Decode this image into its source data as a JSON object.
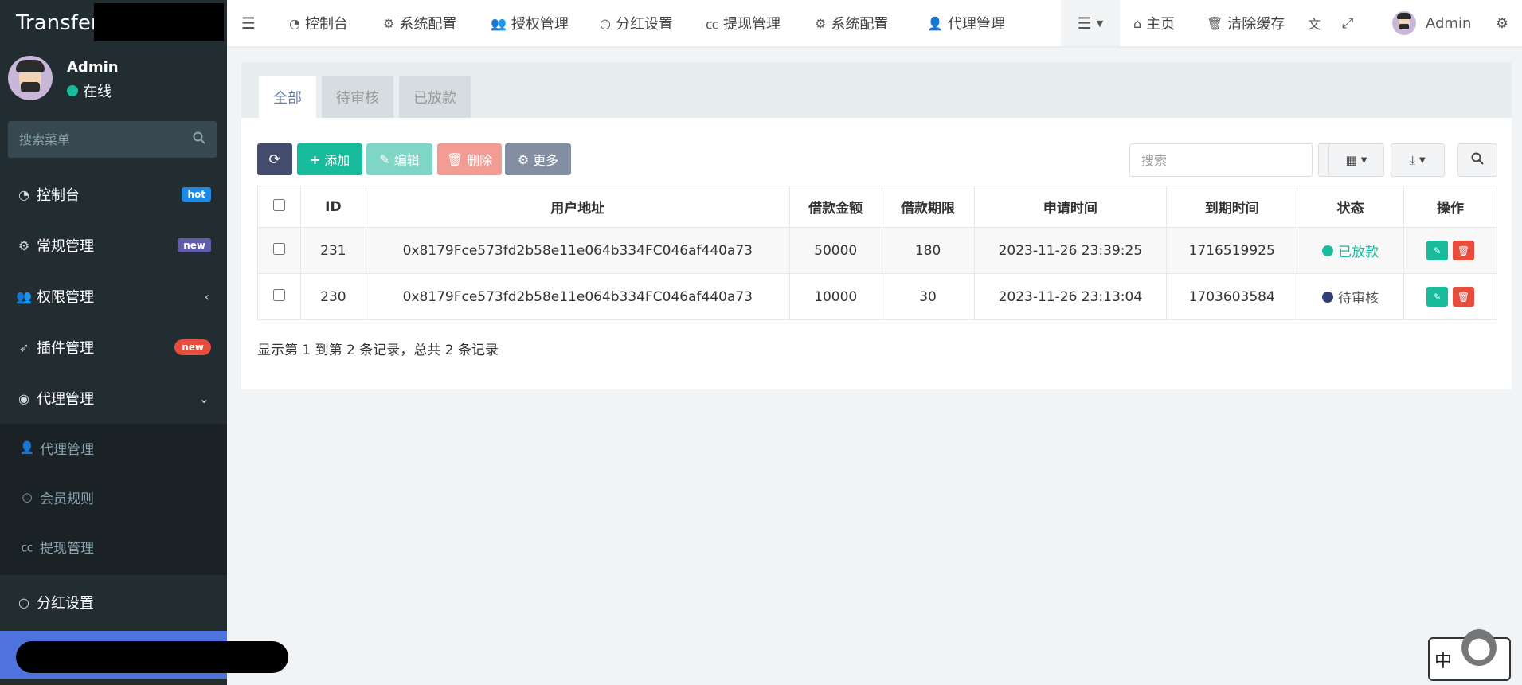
{
  "brand": {
    "title": "Transfer"
  },
  "user": {
    "name": "Admin",
    "status": "在线"
  },
  "sidebar": {
    "search_placeholder": "搜索菜单",
    "items": [
      {
        "label": "控制台",
        "icon": "dashboard-icon",
        "badge": "hot"
      },
      {
        "label": "常规管理",
        "icon": "cogs-icon",
        "badge": "new"
      },
      {
        "label": "权限管理",
        "icon": "users-icon"
      },
      {
        "label": "插件管理",
        "icon": "rocket-icon",
        "badge": "new"
      },
      {
        "label": "代理管理",
        "icon": "user-circle-icon"
      }
    ],
    "subitems": [
      {
        "label": "代理管理",
        "icon": "user-icon"
      },
      {
        "label": "会员规则",
        "icon": "circle-icon"
      },
      {
        "label": "提现管理",
        "icon": "cc-icon"
      }
    ],
    "after": [
      {
        "label": "分红设置",
        "icon": "circle-icon"
      }
    ]
  },
  "navbar": {
    "items": [
      {
        "label": "控制台",
        "icon": "dashboard-icon"
      },
      {
        "label": "系统配置",
        "icon": "gear-icon"
      },
      {
        "label": "授权管理",
        "icon": "users-icon"
      },
      {
        "label": "分红设置",
        "icon": "circle-icon"
      },
      {
        "label": "提现管理",
        "icon": "cc-icon"
      },
      {
        "label": "系统配置",
        "icon": "gear-icon"
      },
      {
        "label": "代理管理",
        "icon": "user-icon"
      }
    ],
    "home": "主页",
    "clear_cache": "清除缓存",
    "admin": "Admin"
  },
  "tabs": [
    "全部",
    "待审核",
    "已放款"
  ],
  "toolbar": {
    "add": "添加",
    "edit": "编辑",
    "delete": "删除",
    "more": "更多",
    "search_placeholder": "搜索"
  },
  "table": {
    "columns": [
      "ID",
      "用户地址",
      "借款金额",
      "借款期限",
      "申请时间",
      "到期时间",
      "状态",
      "操作"
    ],
    "rows": [
      {
        "id": "231",
        "address": "0x8179Fce573fd2b58e11e064b334FC046af440a73",
        "amount": "50000",
        "term": "180",
        "apply_time": "2023-11-26 23:39:25",
        "due_time": "1716519925",
        "status": "已放款"
      },
      {
        "id": "230",
        "address": "0x8179Fce573fd2b58e11e064b334FC046af440a73",
        "amount": "10000",
        "term": "30",
        "apply_time": "2023-11-26 23:13:04",
        "due_time": "1703603584",
        "status": "待审核"
      }
    ]
  },
  "pager": {
    "info": "显示第 1 到第 2 条记录，总共 2 条记录"
  },
  "ime": {
    "label": "中"
  },
  "colors": {
    "sidebar": "#222d32",
    "accent": "#18bc9c",
    "danger": "#e74c3c",
    "active": "#4e73df"
  }
}
